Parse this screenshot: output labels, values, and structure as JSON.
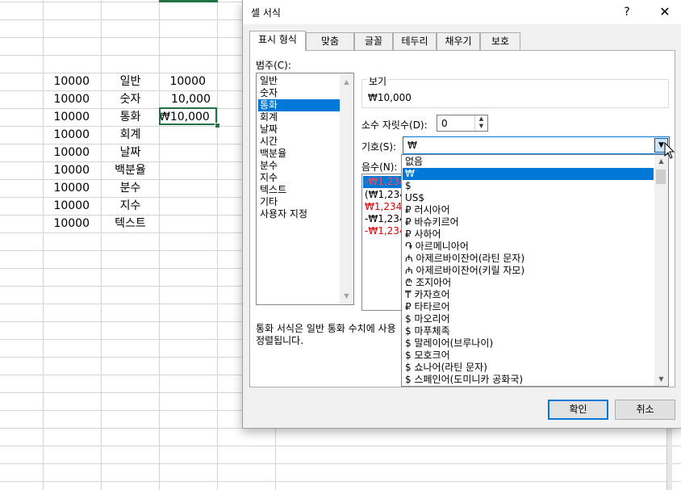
{
  "sheet": {
    "col_a": [
      "10000",
      "10000",
      "10000",
      "10000",
      "10000",
      "10000",
      "10000",
      "10000",
      "10000"
    ],
    "col_b": [
      "일반",
      "숫자",
      "통화",
      "회계",
      "날짜",
      "백분율",
      "분수",
      "지수",
      "텍스트"
    ],
    "col_c": [
      "10000",
      "10,000",
      "₩10,000"
    ]
  },
  "dialog": {
    "title": "셀 서식",
    "help_label": "?",
    "close_label": "✕",
    "tabs": [
      "표시 형식",
      "맞춤",
      "글꼴",
      "테두리",
      "채우기",
      "보호"
    ],
    "category_label": "범주(C):",
    "categories": [
      "일반",
      "숫자",
      "통화",
      "회계",
      "날짜",
      "시간",
      "백분율",
      "분수",
      "지수",
      "텍스트",
      "기타",
      "사용자 지정"
    ],
    "selected_category": "통화",
    "sample_label": "보기",
    "sample_value": "₩10,000",
    "decimal_label": "소수 자릿수(D):",
    "decimal_value": "0",
    "symbol_label": "기호(S):",
    "symbol_value": "₩",
    "negative_label": "음수(N):",
    "negatives": [
      "-₩1,234",
      "(₩1,234)",
      "₩1,234",
      "-₩1,234",
      "-₩1,234"
    ],
    "description_line1": "통화 서식은 일반 통화 수치에 사용",
    "description_line2": "정렬됩니다.",
    "ok_label": "확인",
    "cancel_label": "취소"
  },
  "dropdown": {
    "items": [
      "없음",
      "₩",
      "$",
      "US$",
      "₽ 러시아어",
      "₽ 바슈키르어",
      "₽ 사하어",
      "֏ 아르메니아어",
      "₼ 아제르바이잔어(라틴 문자)",
      "₼ 아제르바이잔어(키릴 자모)",
      "₾ 조지아어",
      "₸ 카자흐어",
      "₽ 타타르어",
      "$ 마오리어",
      "$ 마푸체족",
      "$ 말레이어(브루나이)",
      "$ 모호크어",
      "$ 쇼나어(라틴 문자)",
      "$ 스페인어(도미니카 공화국)"
    ],
    "selected": "₩"
  },
  "colors": {
    "accent": "#0078d7",
    "grid": "#d4d4d4",
    "selection": "#217346",
    "negative": "#e00000"
  }
}
